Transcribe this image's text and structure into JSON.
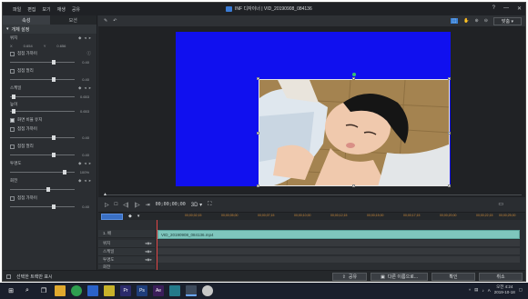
{
  "window": {
    "menu": [
      "파일",
      "편집",
      "보기",
      "재생",
      "공유"
    ],
    "title": "INF 디자이너 | VID_20190908_084136",
    "controls": [
      "?",
      "—",
      "✕"
    ]
  },
  "left_panel": {
    "tabs": [
      "속성",
      "모션"
    ],
    "section_title": "개체 설정",
    "position_label": "위치",
    "position_x_label": "X",
    "position_x": "0.654",
    "position_y_label": "Y",
    "position_y": "0.656",
    "ease_in_1": "점점 가까이",
    "slider_1_val": "0.40",
    "ease_out_1": "점점 멀리",
    "slider_2_val": "0.40",
    "scale_label": "스케일",
    "scale_width_val": "0.653",
    "height_label": "높이",
    "scale_height_val": "0.653",
    "keep_ratio": "화면 비율 유지",
    "ease_in_2": "점점 가까이",
    "slider_5_val": "0.40",
    "ease_out_2": "점점 멀리",
    "slider_6_val": "0.40",
    "opacity_label": "투명도",
    "opacity_val": "100%",
    "rotation_label": "회전",
    "ease_in_3": "점점 가까이",
    "slider_8_val": "0.40"
  },
  "preview_toolbar": {
    "zoom": "맞춤"
  },
  "playback": {
    "timecode": "00;00;00;00",
    "mode": "3D"
  },
  "timeline": {
    "ticks": [
      "00;00;02;15",
      "00;00;05;00",
      "00;00;07;15",
      "00;00;10;00",
      "00;00;12;15",
      "00;00;15;00",
      "00;00;17;15",
      "00;00;20;00",
      "00;00;22;15",
      "00;00;25;00"
    ],
    "tracks": [
      "1. 배",
      "위치",
      "스케일",
      "투명도",
      "회전"
    ],
    "clip_name": "VID_20190908_084136.mp4"
  },
  "bottom_bar": {
    "show_hint": "선택한 트랙만 표시",
    "share_label": "공유",
    "save_as_label": "다른 이름으로...",
    "ok_label": "확인",
    "cancel_label": "취소"
  },
  "taskbar": {
    "time": "오전 4:24",
    "date": "2019-10-18",
    "lang": "A"
  },
  "colors": {
    "canvas_blue": "#1010ef",
    "clip_teal": "#7ec6bd",
    "accent": "#3b82d6"
  }
}
